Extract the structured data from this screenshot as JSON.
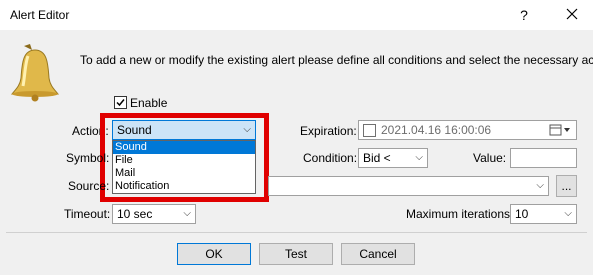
{
  "window": {
    "title": "Alert Editor",
    "help_icon": "?",
    "close_icon": "X"
  },
  "intro_text": "To add a new or modify the existing alert please define all conditions and select the necessary action.",
  "enable": {
    "label": "Enable",
    "checked": true
  },
  "action": {
    "label": "Action:",
    "value": "Sound",
    "options": [
      "Sound",
      "File",
      "Mail",
      "Notification"
    ]
  },
  "symbol": {
    "label": "Symbol:"
  },
  "source": {
    "label": "Source:",
    "browse_label": "..."
  },
  "timeout": {
    "label": "Timeout:",
    "value": "10 sec"
  },
  "expiration": {
    "label": "Expiration:",
    "value": "2021.04.16 16:00:06"
  },
  "condition": {
    "label": "Condition:",
    "value": "Bid <"
  },
  "value_field": {
    "label": "Value:",
    "value": ""
  },
  "max_iterations": {
    "label": "Maximum iterations:",
    "value": "10"
  },
  "buttons": {
    "ok": "OK",
    "test": "Test",
    "cancel": "Cancel"
  },
  "colors": {
    "selection": "#0078d7",
    "highlight": "#e00000"
  }
}
